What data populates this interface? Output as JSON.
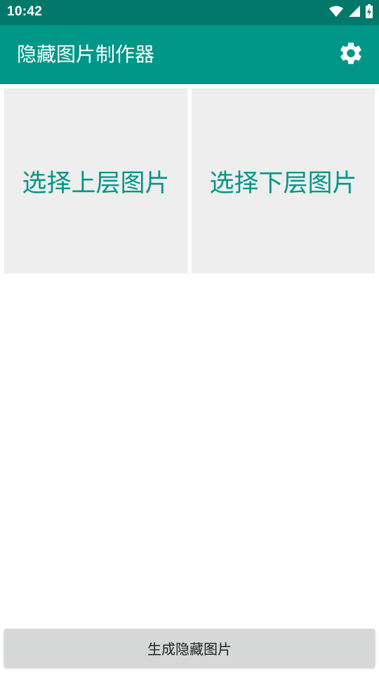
{
  "status_bar": {
    "time": "10:42",
    "icons": [
      "wifi-icon",
      "cellular-signal-icon",
      "battery-charging-icon"
    ]
  },
  "app_bar": {
    "title": "隐藏图片制作器",
    "action_icon": "gear-icon"
  },
  "tiles": {
    "top_layer_label": "选择上层图片",
    "bottom_layer_label": "选择下层图片"
  },
  "footer": {
    "generate_label": "生成隐藏图片"
  },
  "colors": {
    "status_bar": "#00796B",
    "app_bar": "#009688",
    "accent_text": "#009688",
    "tile_background": "#EEEEEE",
    "button_background": "#D6D7D7"
  }
}
